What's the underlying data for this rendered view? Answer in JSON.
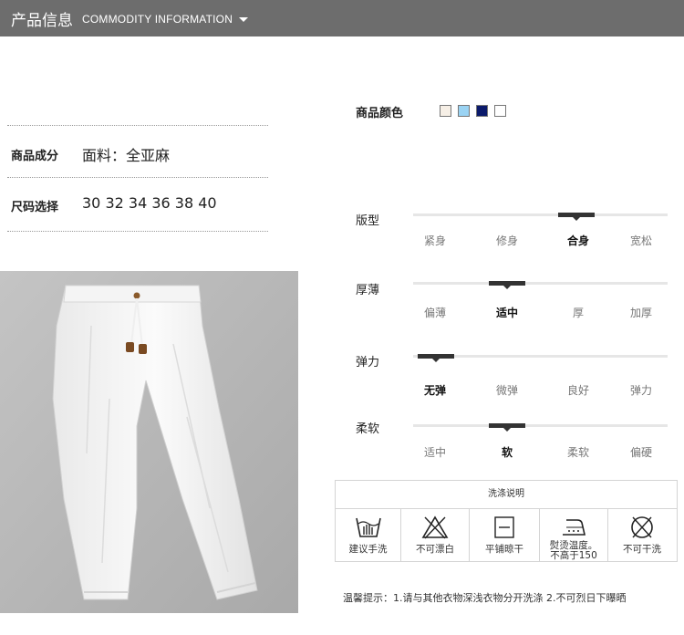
{
  "header": {
    "title_cn": "产品信息",
    "title_en": "COMMODITY INFORMATION",
    "caret_icon": "caret-down-icon"
  },
  "info": {
    "material_label": "商品成分",
    "material_value": "面料：全亚麻",
    "size_label": "尺码选择",
    "size_value": "30 32 34 36 38 40"
  },
  "colors": {
    "label": "商品颜色",
    "swatches": [
      "#f6efe6",
      "#9ad3f3",
      "#0b1a6b",
      "#ffffff"
    ]
  },
  "attributes": [
    {
      "title": "版型",
      "options": [
        "紧身",
        "修身",
        "合身",
        "宽松"
      ],
      "selected": 2,
      "level": 0.64
    },
    {
      "title": "厚薄",
      "options": [
        "偏薄",
        "适中",
        "厚",
        "加厚"
      ],
      "selected": 1,
      "level": 0.37
    },
    {
      "title": "弹力",
      "options": [
        "无弹",
        "微弹",
        "良好",
        "弹力"
      ],
      "selected": 0,
      "level": 0.09
    },
    {
      "title": "柔软",
      "options": [
        "适中",
        "软",
        "柔软",
        "偏硬"
      ],
      "selected": 1,
      "level": 0.37
    }
  ],
  "wash": {
    "title": "洗涤说明",
    "items": [
      {
        "icon": "hand-wash-icon",
        "label": "建议手洗"
      },
      {
        "icon": "no-bleach-icon",
        "label": "不可漂白"
      },
      {
        "icon": "dry-flat-icon",
        "label": "平铺晾干"
      },
      {
        "icon": "iron-icon",
        "label": "熨烫温度。",
        "label2": "不高于150"
      },
      {
        "icon": "no-tumble-dry-icon",
        "label": "不可干洗"
      }
    ]
  },
  "tips": "温馨提示：1.请与其他衣物深浅衣物分开洗涤   2.不可烈日下曝晒"
}
